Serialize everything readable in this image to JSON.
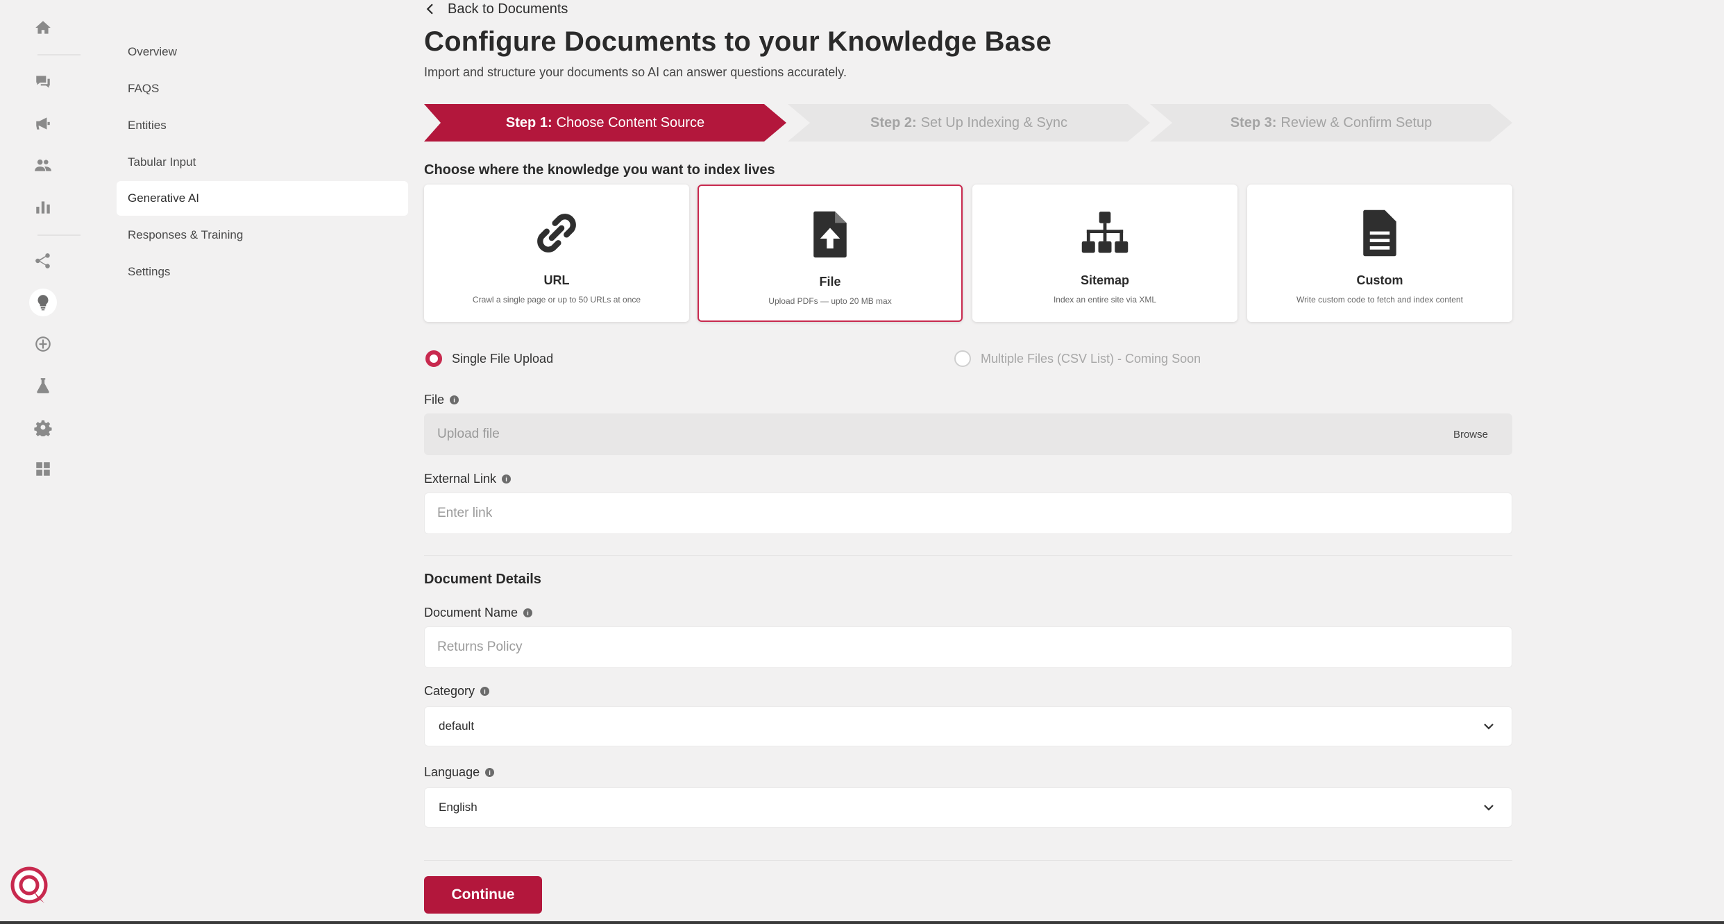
{
  "nav": {
    "rail_icons": [
      "home-icon",
      "chat-icon",
      "megaphone-icon",
      "users-icon",
      "bar-chart-icon",
      "share-icon",
      "lightbulb-icon",
      "globe-icon",
      "flask-icon",
      "gear-icon",
      "grid-icon"
    ],
    "active_rail_icon": "lightbulb-icon",
    "sub_items": [
      {
        "label": "Overview"
      },
      {
        "label": "FAQS"
      },
      {
        "label": "Entities"
      },
      {
        "label": "Tabular Input"
      },
      {
        "label": "Generative AI",
        "active": true
      },
      {
        "label": "Responses & Training"
      },
      {
        "label": "Settings"
      }
    ]
  },
  "header": {
    "back_label": "Back to Documents",
    "title": "Configure Documents to your Knowledge Base",
    "subtitle": "Import and structure your documents so AI can answer questions accurately."
  },
  "steps": [
    {
      "num": "Step 1:",
      "label": "Choose Content Source",
      "active": true
    },
    {
      "num": "Step 2:",
      "label": "Set Up Indexing & Sync",
      "active": false
    },
    {
      "num": "Step 3:",
      "label": "Review & Confirm Setup",
      "active": false
    }
  ],
  "source_prompt": "Choose where the knowledge you want to index lives",
  "sources": [
    {
      "icon": "link-icon",
      "title": "URL",
      "desc": "Crawl a single page or up to 50 URLs at once"
    },
    {
      "icon": "file-upload-icon",
      "title": "File",
      "desc": "Upload PDFs — upto 20 MB max",
      "selected": true
    },
    {
      "icon": "sitemap-icon",
      "title": "Sitemap",
      "desc": "Index an entire site via XML"
    },
    {
      "icon": "document-icon",
      "title": "Custom",
      "desc": "Write custom code to fetch and index content"
    }
  ],
  "upload_mode": {
    "single_label": "Single File Upload",
    "multi_label": "Multiple Files (CSV List) - Coming Soon",
    "selected": "single"
  },
  "form": {
    "file_label": "File",
    "file_placeholder": "Upload file",
    "browse_label": "Browse",
    "external_link_label": "External Link",
    "external_link_placeholder": "Enter link",
    "details_heading": "Document Details",
    "doc_name_label": "Document Name",
    "doc_name_placeholder": "Returns Policy",
    "category_label": "Category",
    "category_value": "default",
    "language_label": "Language",
    "language_value": "English",
    "info_glyph": "i"
  },
  "actions": {
    "continue_label": "Continue"
  },
  "colors": {
    "accent": "#b3173c",
    "selected_border": "#c8294e",
    "background": "#f2f1f1"
  }
}
